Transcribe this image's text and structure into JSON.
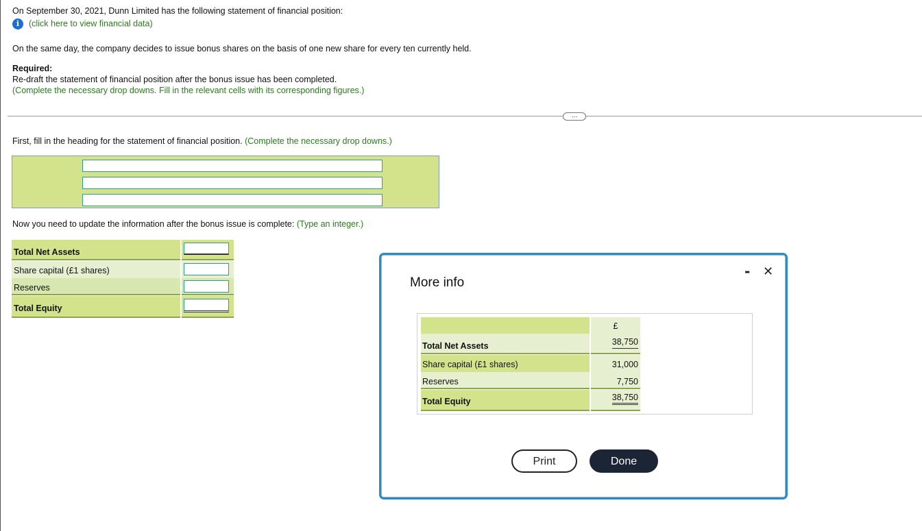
{
  "intro": {
    "line1": "On September 30, 2021, Dunn Limited has the following statement of financial position:",
    "link": "(click here to view financial data)",
    "line2": "On the same day, the company decides to issue bonus shares on the basis of one new share for every ten currently held.",
    "required_label": "Required:",
    "required_text": "Re-draft the statement of financial position after the bonus issue has been completed.",
    "required_hint": "(Complete the necessary drop downs. Fill in the relevant cells with its corresponding figures.)"
  },
  "expander_label": "...",
  "heading_section": {
    "instruction": "First, fill in the heading for the statement of financial position.",
    "hint": "(Complete the necessary drop downs.)"
  },
  "update_section": {
    "instruction": "Now you need to update the information after the bonus issue is complete:",
    "hint": "(Type an integer.)"
  },
  "answer_table": {
    "rows": [
      {
        "label": "Total Net Assets"
      },
      {
        "label": "Share capital (£1 shares)"
      },
      {
        "label": "Reserves"
      },
      {
        "label": "Total Equity"
      }
    ]
  },
  "modal": {
    "title": "More info",
    "minimize": "-",
    "close": "✕",
    "currency": "£",
    "rows": [
      {
        "label": "Total Net Assets",
        "value": "38,750"
      },
      {
        "label": "Share capital (£1 shares)",
        "value": "31,000"
      },
      {
        "label": "Reserves",
        "value": "7,750"
      },
      {
        "label": "Total Equity",
        "value": "38,750"
      }
    ],
    "print_label": "Print",
    "done_label": "Done"
  },
  "colors": {
    "table_green": "#d3e38b",
    "row_light": "#e6efcf",
    "teal_border": "#2e9c93",
    "modal_border": "#2b8cc4",
    "done_bg": "#1b2535"
  }
}
